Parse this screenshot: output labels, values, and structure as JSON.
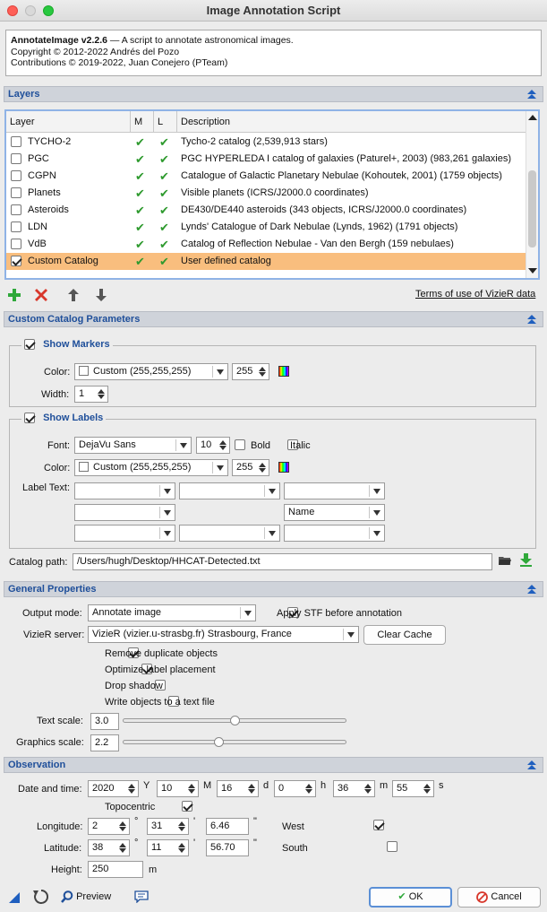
{
  "window": {
    "title": "Image Annotation Script"
  },
  "info": {
    "name": "AnnotateImage v2.2.6",
    "tagline": " — A script to annotate astronomical images.",
    "copyright": "Copyright © 2012-2022 Andrés del Pozo",
    "contrib": "Contributions © 2019-2022, Juan Conejero (PTeam)"
  },
  "layers": {
    "section_title": "Layers",
    "columns": {
      "layer": "Layer",
      "m": "M",
      "l": "L",
      "desc": "Description"
    },
    "rows": [
      {
        "name": "TYCHO-2",
        "checked": false,
        "desc": "Tycho-2 catalog (2,539,913 stars)"
      },
      {
        "name": "PGC",
        "checked": false,
        "desc": "PGC HYPERLEDA I catalog of galaxies (Paturel+, 2003) (983,261 galaxies)"
      },
      {
        "name": "CGPN",
        "checked": false,
        "desc": "Catalogue of Galactic Planetary Nebulae (Kohoutek, 2001) (1759 objects)"
      },
      {
        "name": "Planets",
        "checked": false,
        "desc": "Visible planets (ICRS/J2000.0 coordinates)"
      },
      {
        "name": "Asteroids",
        "checked": false,
        "desc": "DE430/DE440 asteroids (343 objects, ICRS/J2000.0 coordinates)"
      },
      {
        "name": "LDN",
        "checked": false,
        "desc": "Lynds' Catalogue of Dark Nebulae (Lynds, 1962) (1791 objects)"
      },
      {
        "name": "VdB",
        "checked": false,
        "desc": "Catalog of Reflection Nebulae - Van den Bergh (159 nebulaes)"
      },
      {
        "name": "Custom Catalog",
        "checked": true,
        "desc": "User defined catalog"
      }
    ],
    "check_mark": "✔",
    "terms_link": "Terms of use of VizieR data"
  },
  "custom": {
    "section_title": "Custom Catalog Parameters",
    "markers": {
      "title": "Show Markers",
      "color_label": "Color:",
      "color_value": "Custom (255,255,255)",
      "alpha": "255",
      "width_label": "Width:",
      "width_value": "1"
    },
    "labels": {
      "title": "Show Labels",
      "font_label": "Font:",
      "font_value": "DejaVu Sans",
      "font_size": "10",
      "bold": "Bold",
      "italic": "Italic",
      "color_label": "Color:",
      "color_value": "Custom (255,255,255)",
      "alpha": "255",
      "text_label": "Label Text:",
      "name_option": "Name"
    },
    "catalog_label": "Catalog path:",
    "catalog_path": "/Users/hugh/Desktop/HHCAT-Detected.txt"
  },
  "general": {
    "section_title": "General Properties",
    "output_label": "Output mode:",
    "output_value": "Annotate image",
    "apply_stf": "Apply STF before annotation",
    "vizier_label": "VizieR server:",
    "vizier_value": "VizieR (vizier.u-strasbg.fr) Strasbourg, France",
    "clear_cache": "Clear Cache",
    "remove_dup": "Remove duplicate objects",
    "optimize": "Optimize label placement",
    "drop_shadow": "Drop shadow",
    "write_objects": "Write objects to a text file",
    "text_scale_label": "Text scale:",
    "text_scale": "3.0",
    "graphics_scale_label": "Graphics scale:",
    "graphics_scale": "2.2"
  },
  "observation": {
    "section_title": "Observation",
    "date_label": "Date and time:",
    "year": "2020",
    "y": "Y",
    "month": "10",
    "m": "M",
    "day": "16",
    "d": "d",
    "hour": "0",
    "h": "h",
    "minute": "36",
    "mi": "m",
    "second": "55",
    "s": "s",
    "topocentric": "Topocentric",
    "lon_label": "Longitude:",
    "lon_deg": "2",
    "lon_min": "31",
    "lon_sec": "6.46",
    "west": "West",
    "lat_label": "Latitude:",
    "lat_deg": "38",
    "lat_min": "11",
    "lat_sec": "56.70",
    "south": "South",
    "deg_sym": "°",
    "min_sym": "'",
    "sec_sym": "\"",
    "height_label": "Height:",
    "height": "250",
    "height_unit": "m"
  },
  "footer": {
    "preview": "Preview",
    "ok": "OK",
    "cancel": "Cancel"
  }
}
